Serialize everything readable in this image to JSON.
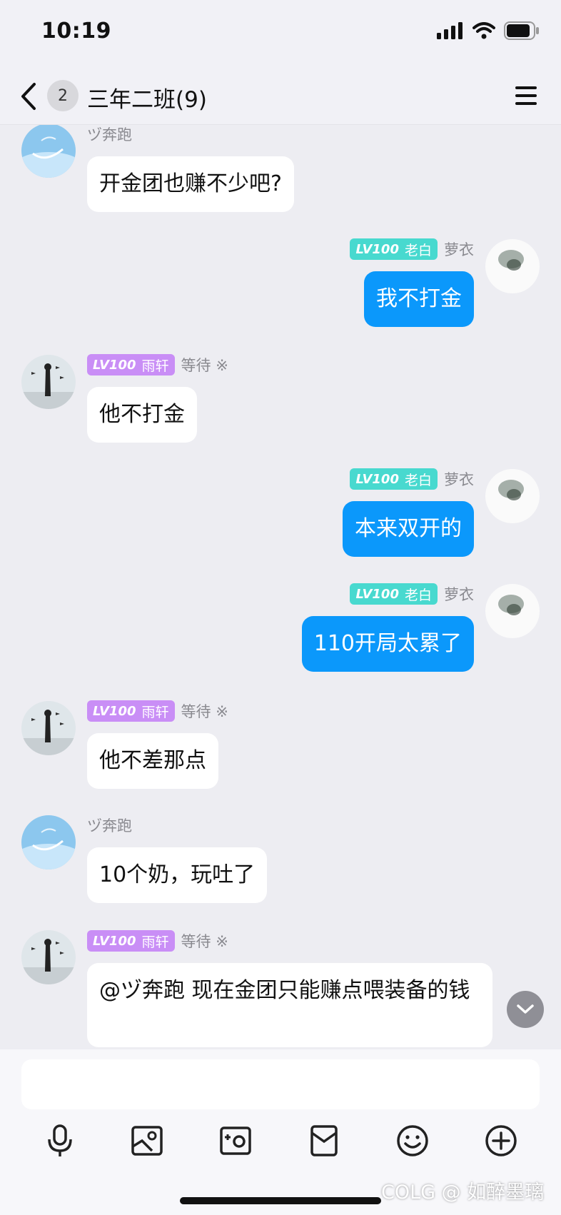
{
  "status": {
    "time": "10:19"
  },
  "header": {
    "back_badge": "2",
    "title": "三年二班(9)"
  },
  "messages": [
    {
      "side": "left",
      "sender": "ヅ奔跑",
      "avatar": "sky-avatar",
      "text": "开金团也赚不少吧?"
    },
    {
      "side": "right",
      "sender": "萝衣",
      "level": "LV100",
      "rank": "老白",
      "avatar": "ink-avatar",
      "text": "我不打金"
    },
    {
      "side": "left",
      "sender": "等待 ※",
      "level": "LV100",
      "rank": "雨轩",
      "avatar": "silhouette-avatar",
      "text": "他不打金"
    },
    {
      "side": "right",
      "sender": "萝衣",
      "level": "LV100",
      "rank": "老白",
      "avatar": "ink-avatar",
      "text": "本来双开的"
    },
    {
      "side": "right",
      "sender": "萝衣",
      "level": "LV100",
      "rank": "老白",
      "avatar": "ink-avatar",
      "text": "110开局太累了"
    },
    {
      "side": "left",
      "sender": "等待 ※",
      "level": "LV100",
      "rank": "雨轩",
      "avatar": "silhouette-avatar",
      "text": "他不差那点"
    },
    {
      "side": "left",
      "sender": "ヅ奔跑",
      "avatar": "sky-avatar",
      "text": "10个奶，玩吐了"
    },
    {
      "side": "left",
      "sender": "等待 ※",
      "level": "LV100",
      "rank": "雨轩",
      "avatar": "silhouette-avatar",
      "text": "@ヅ奔跑 现在金团只能赚点喂装备的钱"
    }
  ],
  "colors": {
    "outgoing_bubble": "#0b98fb",
    "incoming_bubble": "#ffffff",
    "tag_purple": "#c98ef6",
    "tag_teal": "#48d9cf",
    "background": "#ededf2"
  },
  "toolbar_icons": [
    "microphone-icon",
    "image-icon",
    "camera-icon",
    "red-packet-icon",
    "emoji-icon",
    "plus-icon"
  ],
  "watermark": "COLG @ 如醉墨璃"
}
